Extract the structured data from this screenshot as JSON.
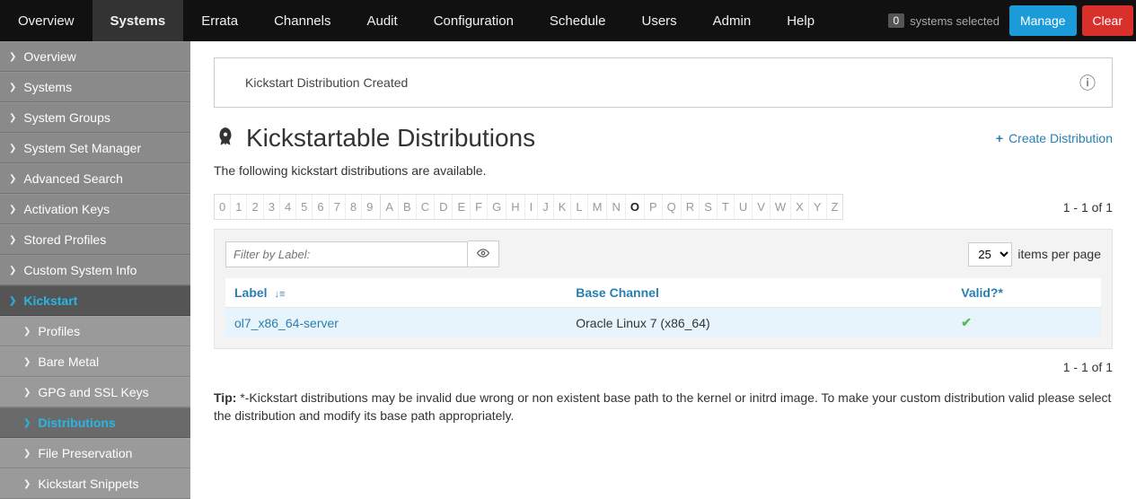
{
  "topnav": {
    "items": [
      "Overview",
      "Systems",
      "Errata",
      "Channels",
      "Audit",
      "Configuration",
      "Schedule",
      "Users",
      "Admin",
      "Help"
    ],
    "active_index": 1,
    "systems_selected_count": "0",
    "systems_selected_label": "systems selected",
    "manage_label": "Manage",
    "clear_label": "Clear"
  },
  "sidebar": {
    "items": [
      {
        "label": "Overview",
        "level": 0
      },
      {
        "label": "Systems",
        "level": 0
      },
      {
        "label": "System Groups",
        "level": 0
      },
      {
        "label": "System Set Manager",
        "level": 0
      },
      {
        "label": "Advanced Search",
        "level": 0
      },
      {
        "label": "Activation Keys",
        "level": 0
      },
      {
        "label": "Stored Profiles",
        "level": 0
      },
      {
        "label": "Custom System Info",
        "level": 0
      },
      {
        "label": "Kickstart",
        "level": 0,
        "active": true
      },
      {
        "label": "Profiles",
        "level": 1
      },
      {
        "label": "Bare Metal",
        "level": 1
      },
      {
        "label": "GPG and SSL Keys",
        "level": 1
      },
      {
        "label": "Distributions",
        "level": 1,
        "active": true
      },
      {
        "label": "File Preservation",
        "level": 1
      },
      {
        "label": "Kickstart Snippets",
        "level": 1
      }
    ]
  },
  "alert": {
    "message": "Kickstart Distribution Created"
  },
  "page": {
    "title": "Kickstartable Distributions",
    "create_label": "Create Distribution",
    "description": "The following kickstart distributions are available."
  },
  "alpha": {
    "numbers": [
      "0",
      "1",
      "2",
      "3",
      "4",
      "5",
      "6",
      "7",
      "8",
      "9"
    ],
    "letters": [
      "A",
      "B",
      "C",
      "D",
      "E",
      "F",
      "G",
      "H",
      "I",
      "J",
      "K",
      "L",
      "M",
      "N",
      "O",
      "P",
      "Q",
      "R",
      "S",
      "T",
      "U",
      "V",
      "W",
      "X",
      "Y",
      "Z"
    ],
    "active": "O"
  },
  "range_top": "1 - 1 of 1",
  "range_bottom": "1 - 1 of 1",
  "filter": {
    "placeholder": "Filter by Label:",
    "per_page_value": "25",
    "per_page_label": "items per page"
  },
  "table": {
    "columns": {
      "label": "Label",
      "base_channel": "Base Channel",
      "valid": "Valid?*"
    },
    "rows": [
      {
        "label": "ol7_x86_64-server",
        "base_channel": "Oracle Linux 7 (x86_64)",
        "valid": true
      }
    ]
  },
  "tip": {
    "prefix": "Tip: ",
    "body": "*-Kickstart distributions may be invalid due wrong or non existent base path to the kernel or initrd image. To make your custom distribution valid please select the distribution and modify its base path appropriately."
  }
}
